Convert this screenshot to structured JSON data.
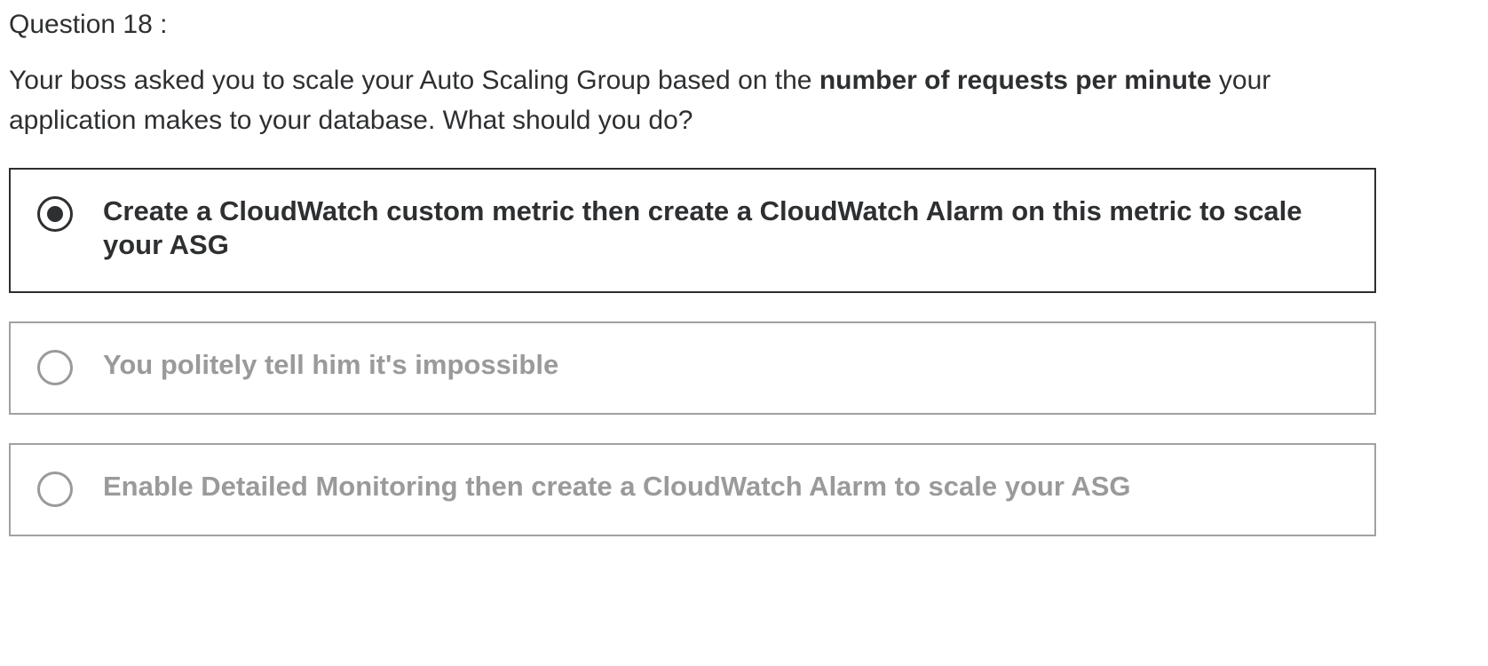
{
  "question": {
    "number_label": "Question 18 :",
    "prompt_before": "Your boss asked you to scale your Auto Scaling Group based on the ",
    "prompt_bold": "number of requests per minute",
    "prompt_after": " your application makes to your database. What should you do?"
  },
  "options": [
    {
      "label": "Create a CloudWatch custom metric then create a CloudWatch Alarm on this metric to scale your ASG",
      "selected": true
    },
    {
      "label": "You politely tell him it's impossible",
      "selected": false
    },
    {
      "label": "Enable Detailed Monitoring then create a CloudWatch Alarm to scale your ASG",
      "selected": false
    }
  ],
  "colors": {
    "text": "#2d2f31",
    "muted": "#9a9a9a",
    "border_muted": "#a1a1a1"
  }
}
